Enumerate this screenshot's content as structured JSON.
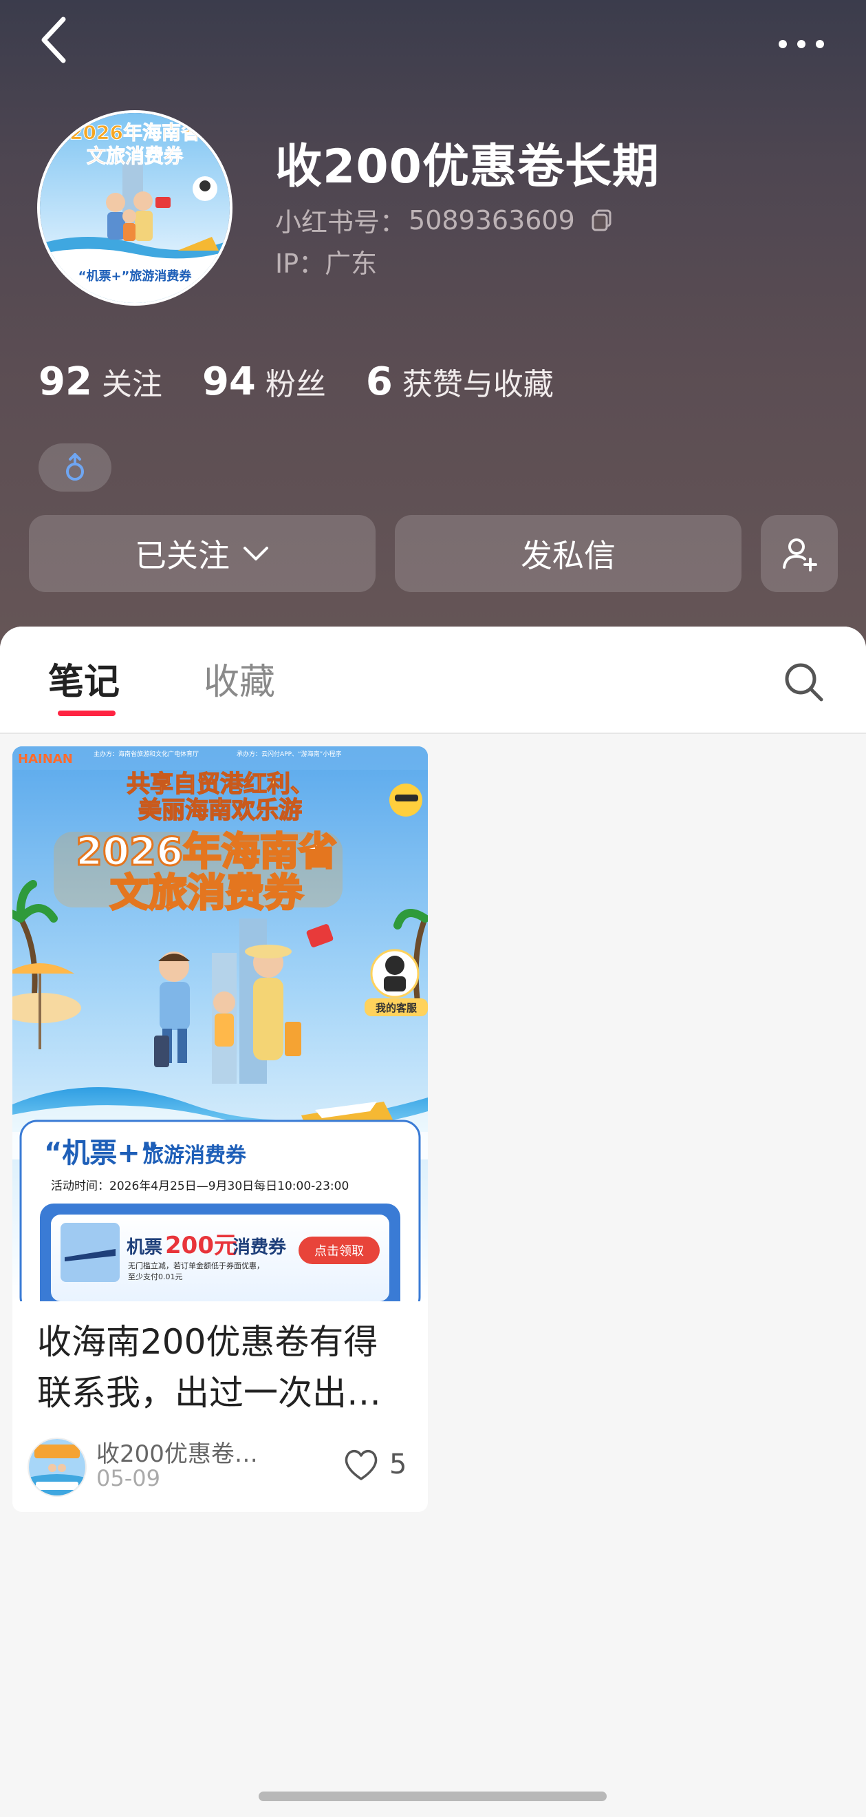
{
  "profile": {
    "username": "收200优惠卷长期",
    "redid_label": "小红书号：",
    "redid": "5089363609",
    "ip": "IP：广东",
    "stats": [
      {
        "num": "92",
        "label": "关注"
      },
      {
        "num": "94",
        "label": "粉丝"
      },
      {
        "num": "6",
        "label": "获赞与收藏"
      }
    ],
    "gender_icon": "male-icon",
    "avatar_text_line1": "2026年海南省",
    "avatar_text_line2": "文旅消费券",
    "avatar_text_bottom": "“机票+”旅游消费券"
  },
  "actions": {
    "follow_label": "已关注",
    "message_label": "发私信"
  },
  "tabs": {
    "notes": "笔记",
    "saved": "收藏"
  },
  "note": {
    "cover": {
      "organizer": "主办方：海南省旅游和文化广电体育厅",
      "operator": "承办方：云闪付APP、“游海南”小程序",
      "logo": "HAINAN",
      "slogan_line1": "共享自贸港红利、",
      "slogan_line2": "美丽海南欢乐游",
      "title_line1": "2026年海南省",
      "title_line2": "文旅消费券",
      "service_badge": "我的客服",
      "section_title_1": "“机票+”",
      "section_title_2": "旅游消费券",
      "activity_time": "活动时间：2026年4月25日—9月30日每日10:00-23:00",
      "coupon_prefix": "机票",
      "coupon_amount": "200元",
      "coupon_suffix": "消费券",
      "coupon_desc_line1": "无门槛立减，若订单金额低于券面优惠，",
      "coupon_desc_line2": "至少支付0.01元",
      "coupon_button": "点击领取"
    },
    "title": "收海南200优惠卷有得联系我，出过一次出…",
    "author": "收200优惠卷…",
    "date": "05-09",
    "likes": "5"
  },
  "colors": {
    "accent": "#ff2442",
    "header_top": "#3b3c4c",
    "header_bottom": "#665657"
  }
}
